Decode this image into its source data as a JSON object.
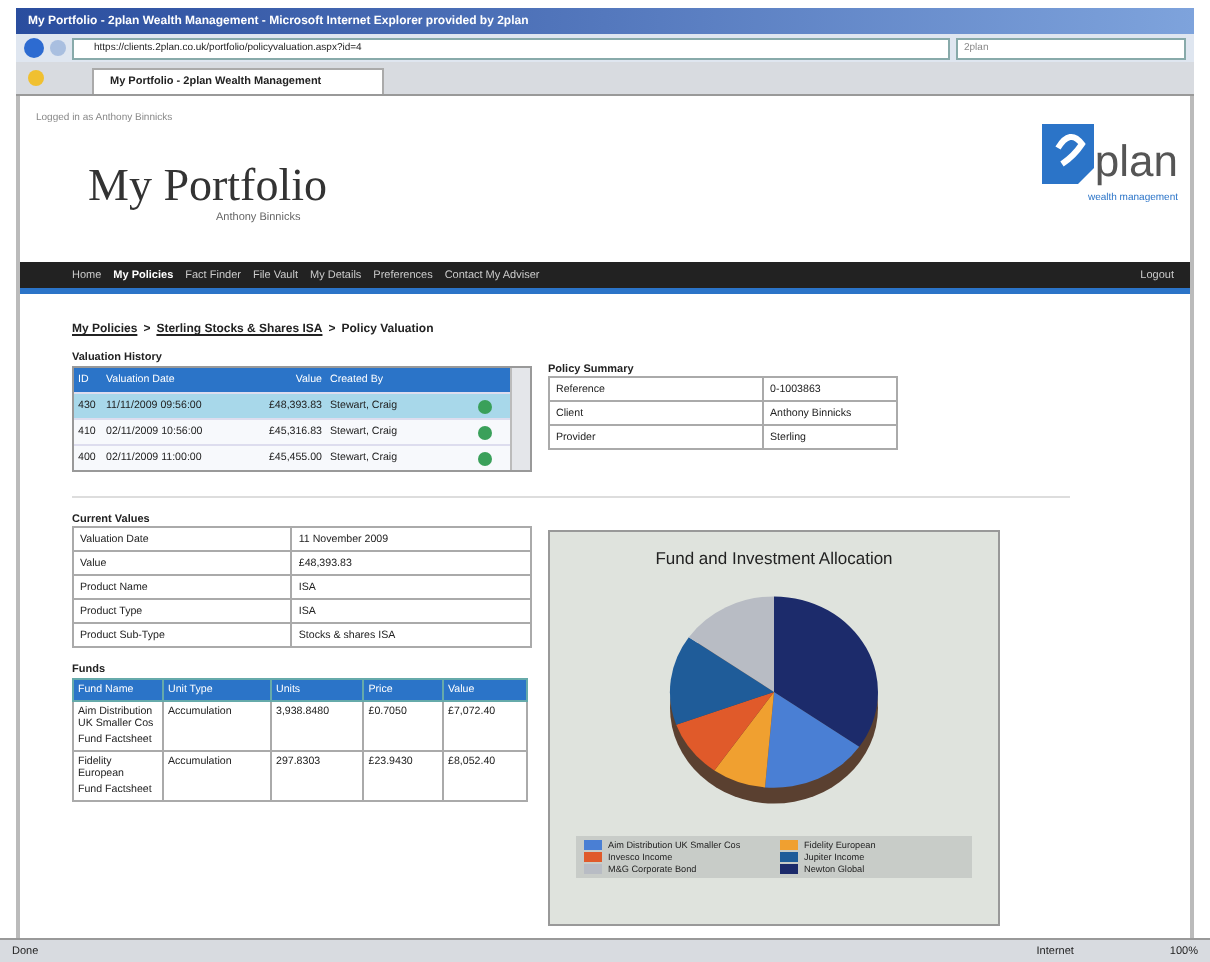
{
  "window": {
    "title": "My Portfolio - 2plan Wealth Management - Microsoft Internet Explorer provided by 2plan"
  },
  "address_bar": {
    "url": "https://clients.2plan.co.uk/portfolio/policyvaluation.aspx?id=4"
  },
  "search": {
    "value": "2plan"
  },
  "tabs": [
    {
      "label": "My Portfolio - 2plan Wealth Management",
      "selected": true
    }
  ],
  "header": {
    "login_info": "Logged in as Anthony Binnicks",
    "title": "My Portfolio",
    "subtitle": "Anthony Binnicks",
    "logo_text": "plan",
    "logo_tagline": "wealth management"
  },
  "nav": {
    "items": [
      {
        "label": "Home",
        "selected": false
      },
      {
        "label": "My Policies",
        "selected": true
      },
      {
        "label": "Fact Finder",
        "selected": false
      },
      {
        "label": "File Vault",
        "selected": false
      },
      {
        "label": "My Details",
        "selected": false
      },
      {
        "label": "Preferences",
        "selected": false
      },
      {
        "label": "Contact My Adviser",
        "selected": false
      }
    ],
    "logout": "Logout"
  },
  "breadcrumb": {
    "separator": ">",
    "items": [
      "My Policies",
      "Sterling Stocks & Shares ISA",
      "Policy Valuation"
    ]
  },
  "valuation_history": {
    "title": "Valuation History",
    "columns": [
      "ID",
      "Valuation Date",
      "Value",
      "Created By"
    ],
    "rows": [
      {
        "cells": [
          "430",
          "11/11/2009 09:56:00",
          "£48,393.83",
          "Stewart, Craig"
        ],
        "selected": true
      },
      {
        "cells": [
          "410",
          "02/11/2009 10:56:00",
          "£45,316.83",
          "Stewart, Craig"
        ],
        "selected": false
      },
      {
        "cells": [
          "400",
          "02/11/2009 11:00:00",
          "£45,455.00",
          "Stewart, Craig"
        ],
        "selected": false
      }
    ]
  },
  "policy_summary": {
    "title": "Policy Summary",
    "rows": [
      [
        "Reference",
        "0-1003863"
      ],
      [
        "Client",
        "Anthony Binnicks"
      ],
      [
        "Provider",
        "Sterling"
      ]
    ]
  },
  "current_values": {
    "title": "Current Values",
    "rows": [
      [
        "Valuation Date",
        "11 November 2009"
      ],
      [
        "Value",
        "£48,393.83"
      ],
      [
        "Product Name",
        "ISA"
      ],
      [
        "Product Type",
        "ISA"
      ],
      [
        "Product Sub-Type",
        "Stocks & shares ISA"
      ]
    ]
  },
  "funds": {
    "title": "Funds",
    "columns": [
      "Fund Name",
      "Unit Type",
      "Units",
      "Price",
      "Value"
    ],
    "rows": [
      {
        "cells": [
          "Aim Distribution UK Smaller Cos",
          "Accumulation",
          "3,938.8480",
          "£0.7050",
          "£7,072.40"
        ],
        "link": "Fund Factsheet"
      },
      {
        "cells": [
          "Fidelity European",
          "Accumulation",
          "297.8303",
          "£23.9430",
          "£8,052.40"
        ],
        "link": "Fund Factsheet"
      }
    ]
  },
  "chart": {
    "title": "Fund and Investment Allocation",
    "legend": [
      {
        "label": "Aim Distribution UK Smaller Cos",
        "color": "#4a7fd4"
      },
      {
        "label": "Fidelity European",
        "color": "#f0a030"
      },
      {
        "label": "Invesco Income",
        "color": "#e05a2a"
      },
      {
        "label": "Jupiter Income",
        "color": "#1f5c99"
      },
      {
        "label": "M&G Corporate Bond",
        "color": "#b8bcc4"
      },
      {
        "label": "Newton Global",
        "color": "#1c2b6b"
      }
    ]
  },
  "status_bar": {
    "text": "Done",
    "zone": "Internet",
    "zoom": "100%"
  }
}
